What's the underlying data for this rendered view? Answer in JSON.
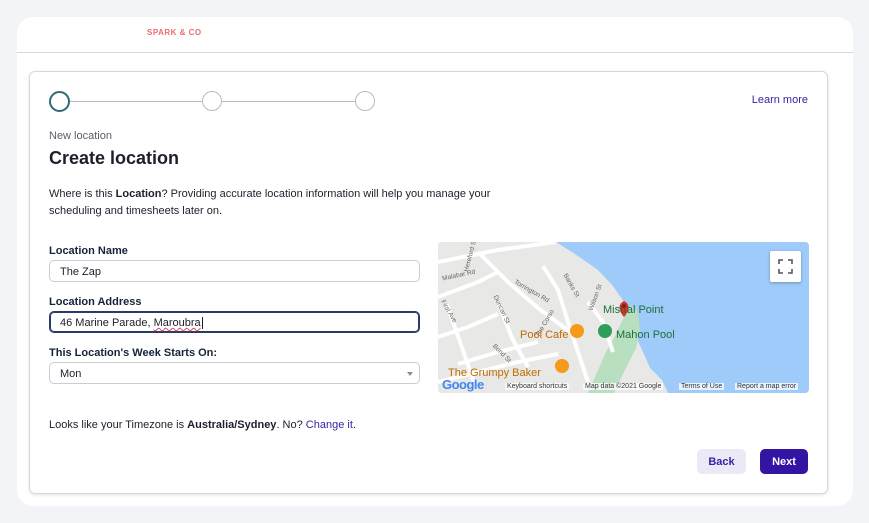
{
  "brand": {
    "name": "SPARK & CO"
  },
  "header": {
    "learn_more": "Learn more"
  },
  "stepper": {
    "steps": 3,
    "active": 1
  },
  "page": {
    "subtitle": "New location",
    "title": "Create location",
    "description_pre": "Where is this ",
    "description_bold": "Location",
    "description_post": "? Providing accurate location information will help you manage your scheduling and timesheets later on."
  },
  "form": {
    "location_name": {
      "label": "Location Name",
      "value": "The Zap"
    },
    "location_address": {
      "label": "Location Address",
      "value_street": "46 Marine Parade, ",
      "value_suburb": "Maroubra"
    },
    "week_start": {
      "label": "This Location's Week Starts On:",
      "value": "Mon"
    }
  },
  "timezone": {
    "pre": "Looks like your Timezone is ",
    "zone": "Australia/Sydney",
    "mid": ". No? ",
    "change_link": "Change it",
    "post": "."
  },
  "buttons": {
    "back": "Back",
    "next": "Next"
  },
  "map": {
    "places": {
      "point": "Mistral Point",
      "pool": "Mahon Pool",
      "cafe": "Pool Cafe",
      "baker": "The Grumpy Baker"
    },
    "streets": [
      "Malabar Rd",
      "Torrington Rd",
      "Banks St",
      "Wilson St",
      "First Ave",
      "Duncan St",
      "The Corso",
      "Bond St",
      "Hereford St"
    ],
    "attribution": {
      "logo": "Google",
      "shortcuts": "Keyboard shortcuts",
      "data": "Map data ©2021 Google",
      "terms": "Terms of Use",
      "report": "Report a map error"
    },
    "colors": {
      "water": "#9fcbfb",
      "land": "#e8e8e6",
      "park": "#b9dfc1",
      "road": "#ffffff",
      "pin": "#d93025"
    }
  }
}
